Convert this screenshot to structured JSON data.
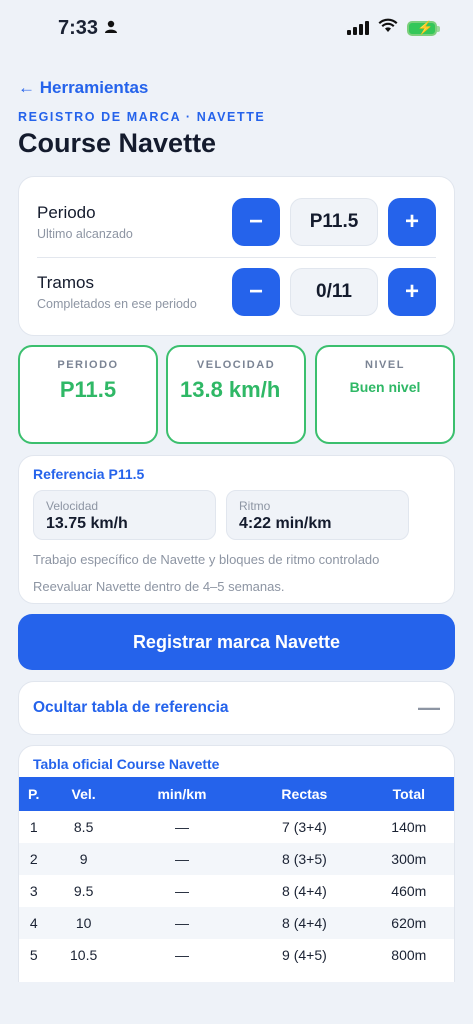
{
  "status": {
    "time": "7:33"
  },
  "nav": {
    "back_label": "← Herramientas"
  },
  "header": {
    "overline": "REGISTRO DE MARCA · NAVETTE",
    "title": "Course Navette"
  },
  "steppers": [
    {
      "label": "Periodo",
      "sublabel": "Ultimo alcanzado",
      "value": "P11.5",
      "minus": "−",
      "plus": "+"
    },
    {
      "label": "Tramos",
      "sublabel": "Completados en ese periodo",
      "value": "0/11",
      "minus": "−",
      "plus": "+"
    }
  ],
  "stats": [
    {
      "label": "PERIODO",
      "value": "P11.5"
    },
    {
      "label": "VELOCIDAD",
      "value": "13.8 km/h"
    },
    {
      "label": "NIVEL",
      "value": "Buen nivel"
    }
  ],
  "reference": {
    "title": "Referencia P11.5",
    "speed_label": "Velocidad",
    "speed_value": "13.75 km/h",
    "pace_label": "Ritmo",
    "pace_value": "4:22 min/km",
    "note1": "Trabajo específico de Navette y bloques de ritmo controlado",
    "note2": "Reevaluar Navette dentro de 4–5 semanas."
  },
  "actions": {
    "register_label": "Registrar marca Navette",
    "toggle_label": "Ocultar tabla de referencia",
    "toggle_icon": "—"
  },
  "table": {
    "title": "Tabla oficial Course Navette",
    "headers": [
      "P.",
      "Vel.",
      "min/km",
      "Rectas",
      "Total"
    ],
    "rows": [
      [
        "1",
        "8.5",
        "—",
        "7 (3+4)",
        "140m"
      ],
      [
        "2",
        "9",
        "—",
        "8 (3+5)",
        "300m"
      ],
      [
        "3",
        "9.5",
        "—",
        "8 (4+4)",
        "460m"
      ],
      [
        "4",
        "10",
        "—",
        "8 (4+4)",
        "620m"
      ],
      [
        "5",
        "10.5",
        "—",
        "9 (4+5)",
        "800m"
      ]
    ]
  },
  "colors": {
    "accent": "#2563eb",
    "success": "#2fb866",
    "background": "#eef2f8"
  }
}
